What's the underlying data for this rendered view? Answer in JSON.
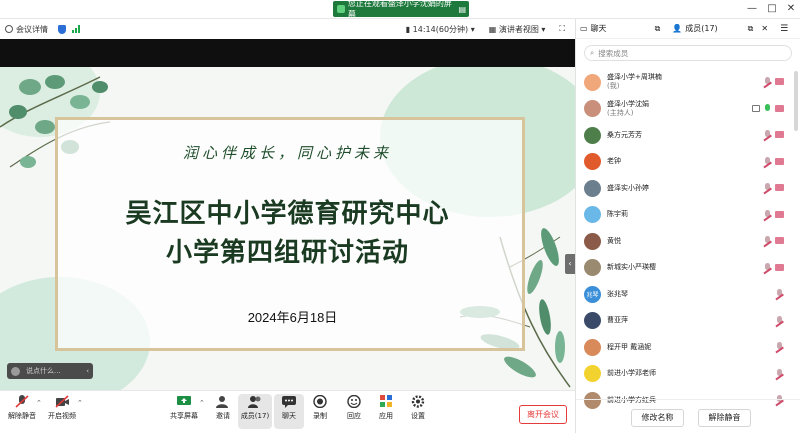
{
  "window": {
    "share_banner": "您正在观看盛泽小学沈娟的屏幕",
    "controls": [
      "—",
      "□",
      "✕"
    ]
  },
  "infobar": {
    "meeting_details": "会议详情",
    "timer": "14:14(60分钟)",
    "view_mode": "演讲者视图"
  },
  "slide": {
    "slogan": "润心伴成长，同心护未来",
    "title_line1": "吴江区中小学德育研究中心",
    "title_line2": "小学第四组研讨活动",
    "date": "2024年6月18日",
    "caption_placeholder": "说点什么..."
  },
  "toolbar": {
    "unmute": "解除静音",
    "start_video": "开启视频",
    "share_screen": "共享屏幕",
    "invite": "邀请",
    "members": "成员(17)",
    "chat": "聊天",
    "record": "录制",
    "reactions": "回应",
    "apps": "应用",
    "settings": "设置",
    "leave": "离开会议"
  },
  "panel": {
    "tab_chat": "聊天",
    "tab_members": "成员(17)",
    "search_placeholder": "搜索成员",
    "members": [
      {
        "name": "盛泽小学+周琪楠",
        "sub": "(我)",
        "color": "#f0a77a",
        "initial": "",
        "mic": "off",
        "cam": true,
        "screen": false
      },
      {
        "name": "盛泽小学沈娟",
        "sub": "(主持人)",
        "color": "#c98f7a",
        "initial": "",
        "mic": "on",
        "cam": true,
        "screen": true
      },
      {
        "name": "桑方元芳芳",
        "sub": "",
        "color": "#4e7f4a",
        "initial": "",
        "mic": "off",
        "cam": true,
        "screen": false
      },
      {
        "name": "老钟",
        "sub": "",
        "color": "#e05a2b",
        "initial": "",
        "mic": "off",
        "cam": true,
        "screen": false
      },
      {
        "name": "盛泽实小孙婷",
        "sub": "",
        "color": "#6b7f8e",
        "initial": "",
        "mic": "off",
        "cam": true,
        "screen": false
      },
      {
        "name": "陈宇莉",
        "sub": "",
        "color": "#6ab8e8",
        "initial": "",
        "mic": "off",
        "cam": true,
        "screen": false
      },
      {
        "name": "黄悦",
        "sub": "",
        "color": "#8c5a48",
        "initial": "",
        "mic": "off",
        "cam": true,
        "screen": false
      },
      {
        "name": "新城实小严瑛樱",
        "sub": "",
        "color": "#9a8a70",
        "initial": "",
        "mic": "off",
        "cam": true,
        "screen": false
      },
      {
        "name": "张兆琴",
        "sub": "",
        "color": "#3a8fd8",
        "initial": "兆琴",
        "mic": "off",
        "cam": false,
        "screen": false
      },
      {
        "name": "曹亚萍",
        "sub": "",
        "color": "#3c4a6a",
        "initial": "",
        "mic": "off",
        "cam": false,
        "screen": false
      },
      {
        "name": "程开甲 戴涵妮",
        "sub": "",
        "color": "#d88a5a",
        "initial": "",
        "mic": "off",
        "cam": false,
        "screen": false
      },
      {
        "name": "前进小学邓老师",
        "sub": "",
        "color": "#f2d22e",
        "initial": "",
        "mic": "off",
        "cam": false,
        "screen": false
      },
      {
        "name": "前进小学方红兵",
        "sub": "",
        "color": "#b08a6a",
        "initial": "",
        "mic": "off",
        "cam": false,
        "screen": false
      }
    ],
    "rename_button": "修改名称",
    "unmute_button": "解除静音"
  }
}
